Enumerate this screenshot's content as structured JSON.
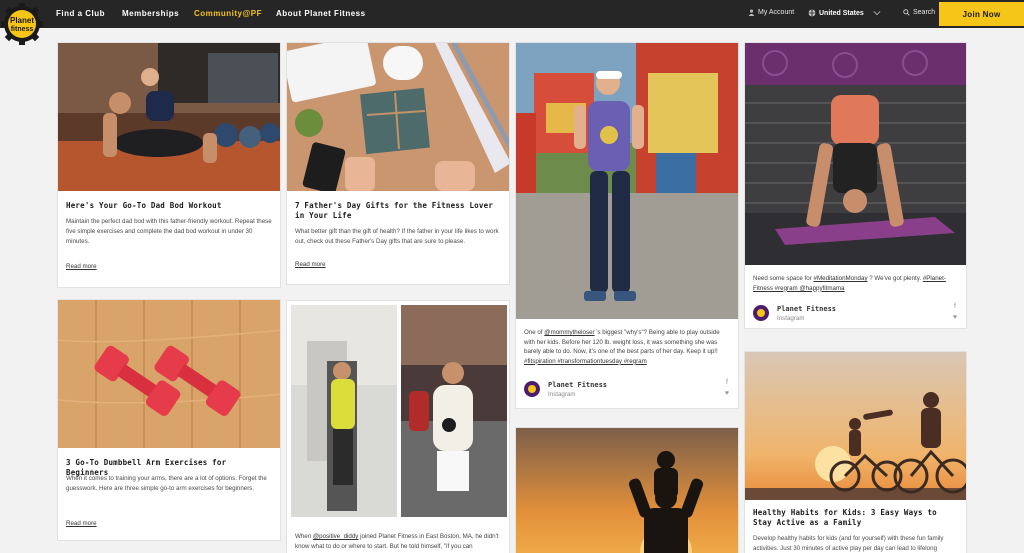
{
  "nav": {
    "logo_text": "Planet fitness",
    "links": [
      {
        "label": "Find a Club"
      },
      {
        "label": "Memberships"
      },
      {
        "label": "Community@PF"
      },
      {
        "label": "About Planet Fitness"
      }
    ],
    "account_label": "My Account",
    "country_label": "United States",
    "search_label": "Search",
    "join_label": "Join Now",
    "accent_color": "#f5c518"
  },
  "cards": {
    "dadbod": {
      "title": "Here's Your Go-To Dad Bod Workout",
      "desc": "Maintain the perfect dad bod with this father-friendly workout. Repeat these five simple exercises and complete the dad bod workout in under 30 minutes.",
      "more": "Read more"
    },
    "gifts": {
      "title": "7 Father's Day Gifts for the Fitness Lover in Your Life",
      "desc": "What better gift than the gift of health? If the father in your life likes to work out, check out these Father's Day gifts that are sure to please.",
      "more": "Read more"
    },
    "mommy": {
      "text_prefix": "One of ",
      "handle": "@mommytheloser",
      "text_body": " 's biggest \"why's\"? Being able to play outside with her kids. Before her 120 lb. weight loss, it was something she was barely able to do. Now, it's one of the best parts of her day. Keep it up!! ",
      "tags": "#fitspiration #transformationtuesday #regram",
      "author": "Planet Fitness",
      "source": "Instagram"
    },
    "meditation": {
      "text_prefix": "Need some space for ",
      "tag1": "#MeditationMonday",
      "text_mid": " ? We've got plenty. ",
      "tags": "#Planet-Fitness #regram @happyfitmama",
      "author": "Planet Fitness",
      "source": "Instagram"
    },
    "dumbbell": {
      "title": "3 Go-To Dumbbell Arm Exercises for Beginners",
      "desc": "When it comes to training your arms, there are a lot of options. Forget the guesswork. Here are three simple go-to arm exercises for beginners.",
      "more": "Read more"
    },
    "boston": {
      "text_prefix": "When ",
      "handle1": "@positive_diddy",
      "text_body": " joined Planet Fitness in East Boston, MA, he didn't know what to do or where to start. But he told himself, \"if you can"
    },
    "healthy": {
      "title": "Healthy Habits for Kids: 3 Easy Ways to Stay Active as a Family",
      "desc": "Develop healthy habits for kids (and for yourself) with these fun family activities. Just 30 minutes of active play per day can lead to lifelong"
    }
  }
}
